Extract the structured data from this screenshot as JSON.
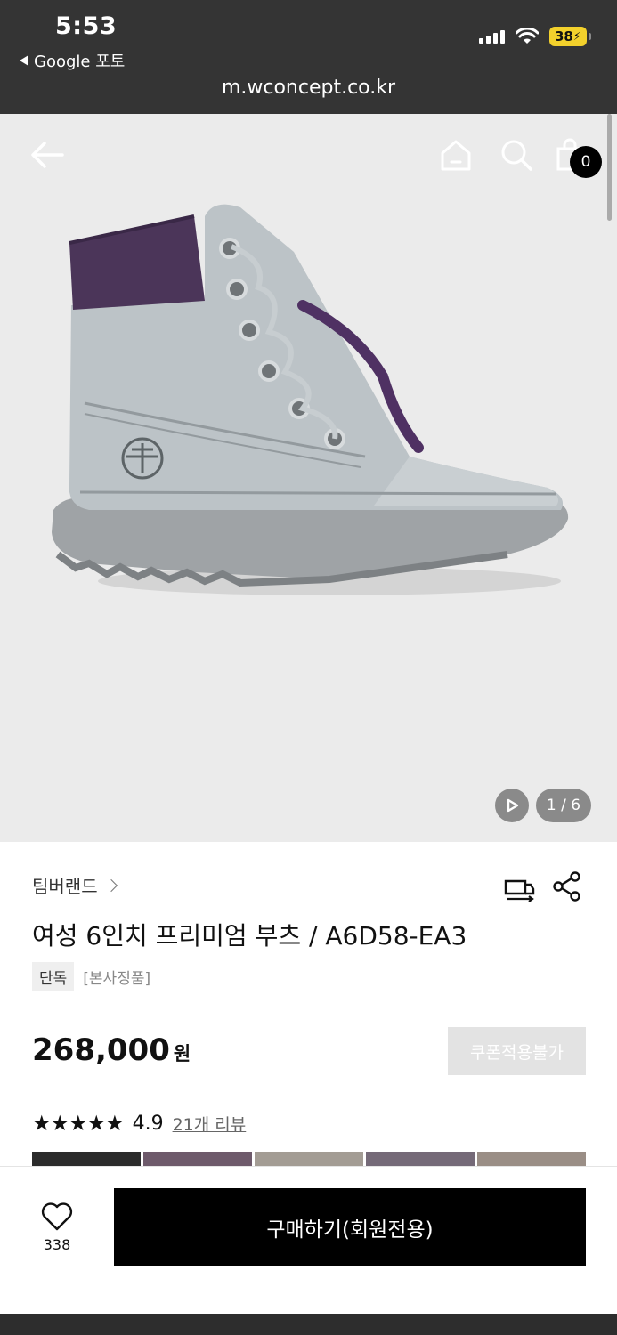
{
  "status_bar": {
    "time": "5:53",
    "back_app": "Google 포토",
    "battery": "38"
  },
  "browser": {
    "url": "m.wconcept.co.kr"
  },
  "header": {
    "cart_count": "0"
  },
  "gallery": {
    "counter": "1 / 6"
  },
  "product": {
    "brand": "팀버랜드",
    "title": "여성 6인치 프리미엄 부츠 / A6D58-EA3",
    "tags": [
      "단독",
      "[본사정품]"
    ],
    "price": "268,000",
    "price_unit": "원",
    "coupon_label": "쿠폰적용불가",
    "stars": "★★★★★",
    "rating": "4.9",
    "review_link": "21개 리뷰"
  },
  "bottom_bar": {
    "like_count": "338",
    "buy_label": "구매하기(회원전용)"
  },
  "colors": {
    "accent": "#000000",
    "boot_body": "#b9c0c4",
    "boot_collar": "#4b3559",
    "disabled_button": "#e3e3e3"
  }
}
